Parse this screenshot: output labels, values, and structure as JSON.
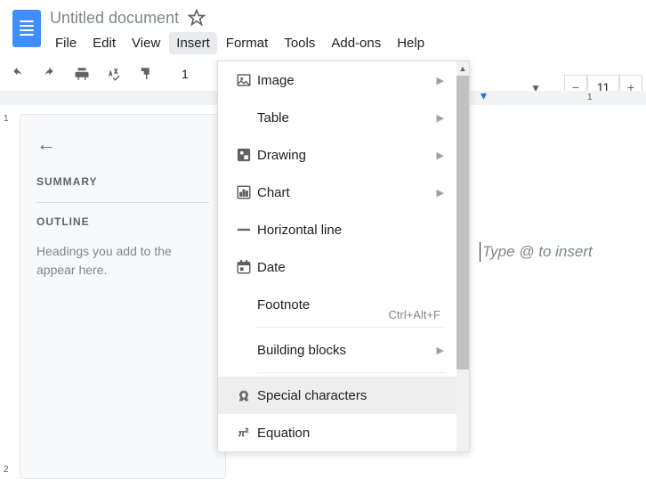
{
  "header": {
    "title": "Untitled document",
    "menus": [
      "File",
      "Edit",
      "View",
      "Insert",
      "Format",
      "Tools",
      "Add-ons",
      "Help"
    ],
    "active_menu_index": 3
  },
  "toolbar": {
    "font_size": "11",
    "btn_undo": "undo",
    "btn_redo": "redo",
    "btn_print": "print",
    "btn_spellcheck": "spellcheck",
    "btn_paintformat": "paint-format"
  },
  "ruler": {
    "mark_1": "1"
  },
  "vruler": {
    "mark_1": "1",
    "mark_2": "2"
  },
  "sidebar": {
    "summary_label": "SUMMARY",
    "outline_label": "OUTLINE",
    "outline_hint": "Headings you add to the\nappear here."
  },
  "page": {
    "placeholder": "Type @ to insert"
  },
  "insert_menu": {
    "items": [
      {
        "key": "image",
        "label": "Image",
        "icon": "image",
        "submenu": true
      },
      {
        "key": "table",
        "label": "Table",
        "icon": "",
        "submenu": true
      },
      {
        "key": "drawing",
        "label": "Drawing",
        "icon": "drawing",
        "submenu": true
      },
      {
        "key": "chart",
        "label": "Chart",
        "icon": "chart",
        "submenu": true
      },
      {
        "key": "hr",
        "label": "Horizontal line",
        "icon": "hr",
        "submenu": false
      },
      {
        "key": "date",
        "label": "Date",
        "icon": "date",
        "submenu": false
      },
      {
        "key": "footnote",
        "label": "Footnote",
        "icon": "",
        "submenu": false,
        "shortcut": "Ctrl+Alt+F",
        "sep_after": true
      },
      {
        "key": "building",
        "label": "Building blocks",
        "icon": "",
        "submenu": true,
        "sep_after": true
      },
      {
        "key": "special",
        "label": "Special characters",
        "icon": "omega",
        "submenu": false,
        "highlight": true
      },
      {
        "key": "equation",
        "label": "Equation",
        "icon": "pi",
        "submenu": false
      }
    ]
  }
}
